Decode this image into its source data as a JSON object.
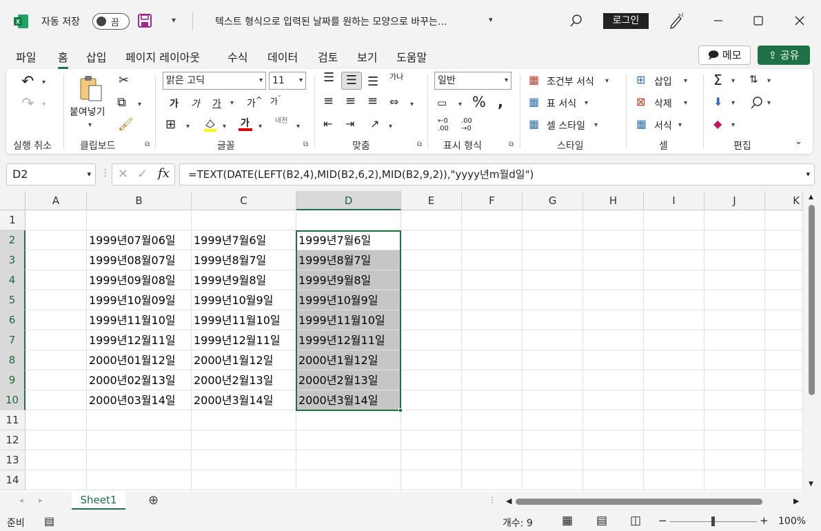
{
  "titlebar": {
    "autosave_label": "자동 저장",
    "autosave_state": "끔",
    "doc_title": "텍스트 형식으로 입력된 날짜를 원하는 모양으로 바꾸는...",
    "login_label": "로그인"
  },
  "tabs": [
    "파일",
    "홈",
    "삽입",
    "페이지 레이아웃",
    "수식",
    "데이터",
    "검토",
    "보기",
    "도움말"
  ],
  "active_tab": "홈",
  "memo_label": "메모",
  "share_label": "공유",
  "ribbon": {
    "undo_group": "실행 취소",
    "clipboard_group": "클립보드",
    "paste_label": "붙여넣기",
    "font_group": "글꼴",
    "font_name": "맑은 고딕",
    "font_size": "11",
    "align_group": "맞춤",
    "number_group": "표시 형식",
    "number_format": "일반",
    "styles_group": "스타일",
    "cond_format": "조건부 서식",
    "table_format": "표 서식",
    "cell_style": "셀 스타일",
    "cells_group": "셀",
    "insert_label": "삽입",
    "delete_label": "삭제",
    "format_label": "서식",
    "edit_group": "편집",
    "wrap_text_icon": "가나",
    "hanja_icon": "내천"
  },
  "formula_bar": {
    "name_box": "D2",
    "formula": "=TEXT(DATE(LEFT(B2,4),MID(B2,6,2),MID(B2,9,2)),\"yyyy년m월d일\")"
  },
  "grid": {
    "columns": [
      "A",
      "B",
      "C",
      "D",
      "E",
      "F",
      "G",
      "H",
      "I",
      "J",
      "K"
    ],
    "rows": [
      "1",
      "2",
      "3",
      "4",
      "5",
      "6",
      "7",
      "8",
      "9",
      "10",
      "11",
      "12",
      "13",
      "14"
    ],
    "data": [
      [
        "",
        "",
        "",
        ""
      ],
      [
        "",
        "1999년07월06일",
        "1999년7월6일",
        "1999년7월6일"
      ],
      [
        "",
        "1999년08월07일",
        "1999년8월7일",
        "1999년8월7일"
      ],
      [
        "",
        "1999년09월08일",
        "1999년9월8일",
        "1999년9월8일"
      ],
      [
        "",
        "1999년10월09일",
        "1999년10월9일",
        "1999년10월9일"
      ],
      [
        "",
        "1999년11월10일",
        "1999년11월10일",
        "1999년11월10일"
      ],
      [
        "",
        "1999년12월11일",
        "1999년12월11일",
        "1999년12월11일"
      ],
      [
        "",
        "2000년01월12일",
        "2000년1월12일",
        "2000년1월12일"
      ],
      [
        "",
        "2000년02월13일",
        "2000년2월13일",
        "2000년2월13일"
      ],
      [
        "",
        "2000년03월14일",
        "2000년3월14일",
        "2000년3월14일"
      ]
    ],
    "selected_column": "D",
    "selected_rows": [
      "2",
      "3",
      "4",
      "5",
      "6",
      "7",
      "8",
      "9",
      "10"
    ]
  },
  "sheet_tab": "Sheet1",
  "status": {
    "ready": "준비",
    "count": "개수: 9",
    "zoom": "100%"
  },
  "colors": {
    "accent": "#1e7145",
    "selection_fill": "#c6c6c6"
  }
}
